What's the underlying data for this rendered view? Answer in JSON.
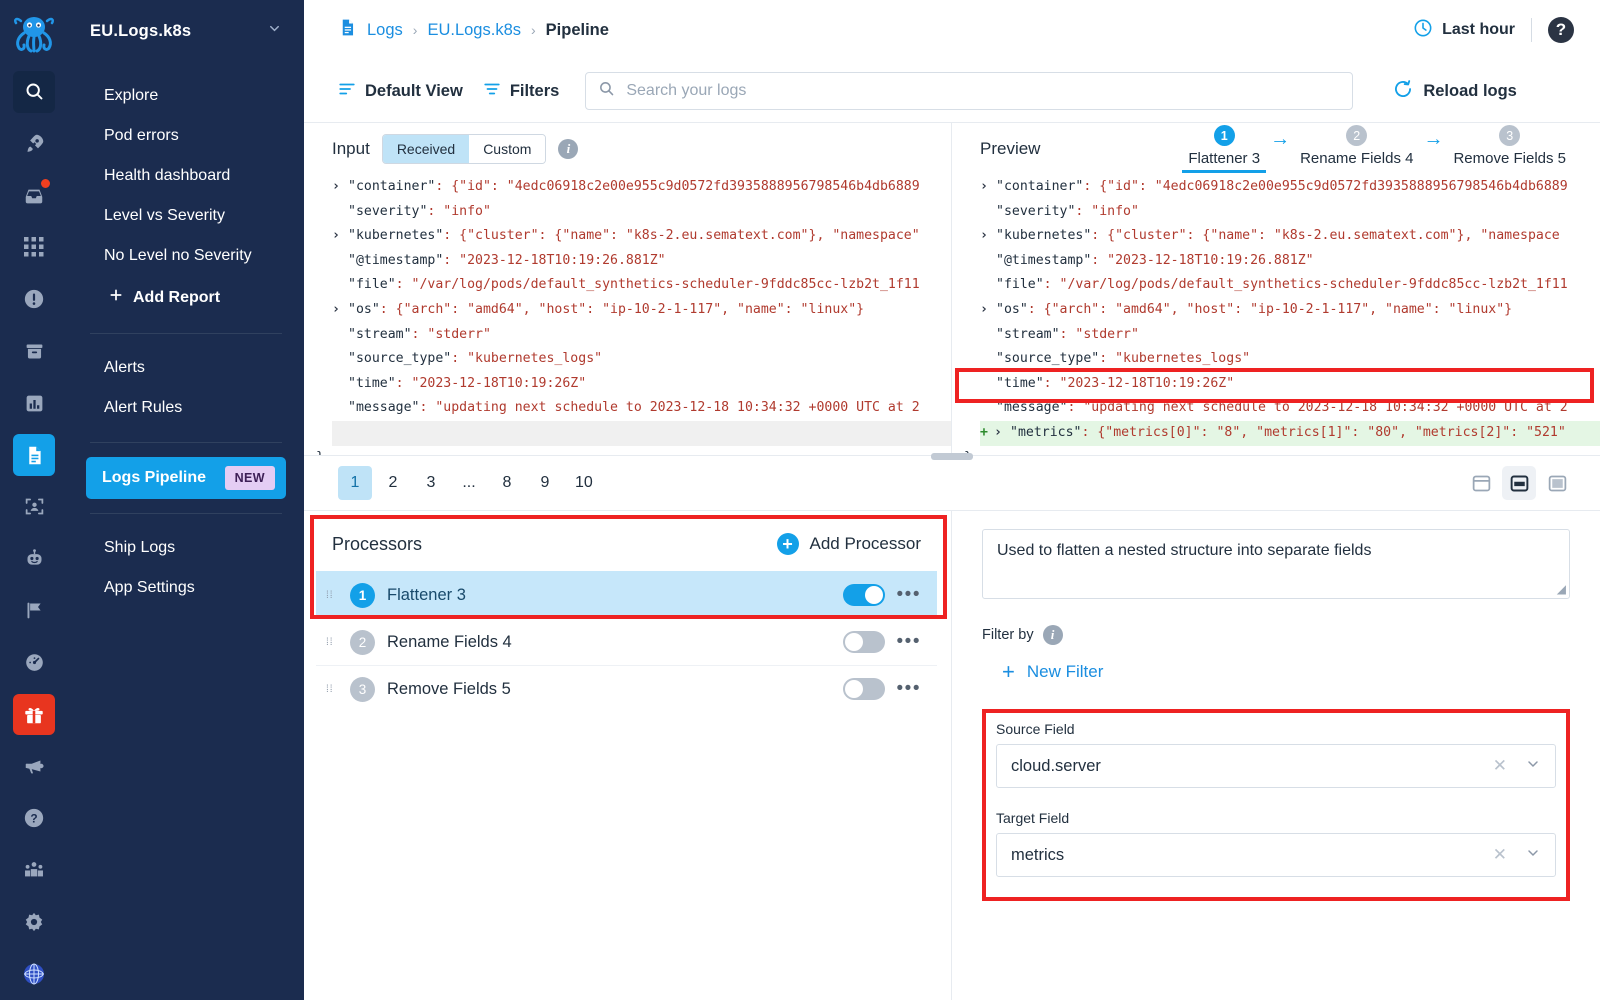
{
  "rail": {
    "logo": "octopus-logo",
    "icons": [
      {
        "name": "search-icon",
        "state": "active-dark"
      },
      {
        "name": "rocket-icon",
        "state": "normal"
      },
      {
        "name": "inbox-icon",
        "state": "normal",
        "badge": true
      },
      {
        "name": "grid-icon",
        "state": "normal"
      },
      {
        "name": "alert-icon",
        "state": "normal"
      },
      {
        "name": "archive-icon",
        "state": "normal"
      },
      {
        "name": "bar-chart-icon",
        "state": "normal"
      },
      {
        "name": "logs-document-icon",
        "state": "active-blue"
      },
      {
        "name": "profile-scan-icon",
        "state": "normal"
      },
      {
        "name": "robot-icon",
        "state": "normal"
      },
      {
        "name": "flag-icon",
        "state": "normal"
      },
      {
        "name": "speedometer-icon",
        "state": "normal"
      }
    ],
    "bottom_icons": [
      {
        "name": "gift-icon",
        "state": "gift"
      },
      {
        "name": "megaphone-icon",
        "state": "normal"
      },
      {
        "name": "help-icon",
        "state": "normal"
      },
      {
        "name": "people-icon",
        "state": "normal"
      },
      {
        "name": "gear-icon",
        "state": "normal"
      },
      {
        "name": "globe-icon",
        "state": "globe"
      }
    ]
  },
  "sidebar": {
    "app_name": "EU.Logs.k8s",
    "chevron": "chevron-down-icon",
    "reports": [
      {
        "label": "Explore"
      },
      {
        "label": "Pod errors"
      },
      {
        "label": "Health dashboard"
      },
      {
        "label": "Level vs Severity"
      },
      {
        "label": "No Level no Severity"
      }
    ],
    "add_report": "Add Report",
    "alerts": [
      {
        "label": "Alerts"
      },
      {
        "label": "Alert Rules"
      }
    ],
    "pipeline": {
      "label": "Logs Pipeline",
      "badge": "NEW"
    },
    "settings": [
      {
        "label": "Ship Logs"
      },
      {
        "label": "App Settings"
      }
    ]
  },
  "header": {
    "breadcrumb": [
      {
        "label": "Logs",
        "type": "link"
      },
      {
        "label": "EU.Logs.k8s",
        "type": "link"
      },
      {
        "label": "Pipeline",
        "type": "current"
      }
    ],
    "time_range": "Last hour",
    "help": "?"
  },
  "toolbar": {
    "default_view": "Default View",
    "filters": "Filters",
    "search_placeholder": "Search your logs",
    "search_value": "",
    "reload": "Reload logs"
  },
  "input_panel": {
    "title": "Input",
    "tabs": [
      {
        "label": "Received",
        "selected": true
      },
      {
        "label": "Custom",
        "selected": false
      }
    ],
    "info": "i",
    "lines": [
      {
        "caret": true,
        "key": "\"container\"",
        "value": ": {\"id\": \"4edc06918c2e00e955c9d0572fd3935888956798546b4db6889"
      },
      {
        "caret": false,
        "key": "\"severity\"",
        "value": ": \"info\""
      },
      {
        "caret": true,
        "key": "\"kubernetes\"",
        "value": ": {\"cluster\": {\"name\": \"k8s-2.eu.sematext.com\"}, \"namespace\""
      },
      {
        "caret": false,
        "key": "\"@timestamp\"",
        "value": ": \"2023-12-18T10:19:26.881Z\""
      },
      {
        "caret": false,
        "key": "\"file\"",
        "value": ": \"/var/log/pods/default_synthetics-scheduler-9fddc85cc-lzb2t_1f11"
      },
      {
        "caret": true,
        "key": "\"os\"",
        "value": ": {\"arch\": \"amd64\", \"host\": \"ip-10-2-1-117\", \"name\": \"linux\"}"
      },
      {
        "caret": false,
        "key": "\"stream\"",
        "value": ": \"stderr\""
      },
      {
        "caret": false,
        "key": "\"source_type\"",
        "value": ": \"kubernetes_logs\""
      },
      {
        "caret": false,
        "key": "\"time\"",
        "value": ": \"2023-12-18T10:19:26Z\""
      },
      {
        "caret": false,
        "key": "\"message\"",
        "value": ": \"updating next schedule to 2023-12-18 10:34:32 +0000 UTC at 2"
      }
    ],
    "closing_brace": "}"
  },
  "preview_panel": {
    "title": "Preview",
    "steps": [
      {
        "num": "1",
        "label": "Flattener 3",
        "active": true
      },
      {
        "num": "2",
        "label": "Rename Fields 4",
        "active": false
      },
      {
        "num": "3",
        "label": "Remove Fields 5",
        "active": false
      }
    ],
    "arrow": "arrow-right-icon",
    "lines": [
      {
        "caret": true,
        "key": "\"container\"",
        "value": ": {\"id\": \"4edc06918c2e00e955c9d0572fd3935888956798546b4db6889"
      },
      {
        "caret": false,
        "key": "\"severity\"",
        "value": ": \"info\""
      },
      {
        "caret": true,
        "key": "\"kubernetes\"",
        "value": ": {\"cluster\": {\"name\": \"k8s-2.eu.sematext.com\"}, \"namespace"
      },
      {
        "caret": false,
        "key": "\"@timestamp\"",
        "value": ": \"2023-12-18T10:19:26.881Z\""
      },
      {
        "caret": false,
        "key": "\"file\"",
        "value": ": \"/var/log/pods/default_synthetics-scheduler-9fddc85cc-lzb2t_1f11"
      },
      {
        "caret": true,
        "key": "\"os\"",
        "value": ": {\"arch\": \"amd64\", \"host\": \"ip-10-2-1-117\", \"name\": \"linux\"}"
      },
      {
        "caret": false,
        "key": "\"stream\"",
        "value": ": \"stderr\""
      },
      {
        "caret": false,
        "key": "\"source_type\"",
        "value": ": \"kubernetes_logs\""
      },
      {
        "caret": false,
        "key": "\"time\"",
        "value": ": \"2023-12-18T10:19:26Z\""
      },
      {
        "caret": false,
        "key": "\"message\"",
        "value": ": \"updating next schedule to 2023-12-18 10:34:32 +0000 UTC at 2"
      }
    ],
    "added_line": {
      "plus": "+",
      "caret": true,
      "key": "\"metrics\"",
      "value": ": {\"metrics[0]\": \"8\", \"metrics[1]\": \"80\", \"metrics[2]\": \"521\""
    },
    "closing_brace": "}"
  },
  "pagination": {
    "pages": [
      "1",
      "2",
      "3",
      "...",
      "8",
      "9",
      "10"
    ],
    "current": "1",
    "view_toggles": [
      {
        "name": "layout-top-icon",
        "selected": false
      },
      {
        "name": "layout-split-icon",
        "selected": true
      },
      {
        "name": "layout-full-icon",
        "selected": false
      }
    ]
  },
  "processors": {
    "title": "Processors",
    "add_label": "Add Processor",
    "rows": [
      {
        "num": "1",
        "name": "Flattener 3",
        "enabled": true,
        "selected": true
      },
      {
        "num": "2",
        "name": "Rename Fields 4",
        "enabled": false,
        "selected": false
      },
      {
        "num": "3",
        "name": "Remove Fields 5",
        "enabled": false,
        "selected": false
      }
    ]
  },
  "detail": {
    "description": "Used to flatten a nested structure into separate fields",
    "filter_by_label": "Filter by",
    "filter_info": "i",
    "new_filter": "New Filter",
    "source_field_label": "Source Field",
    "source_field_value": "cloud.server",
    "target_field_label": "Target Field",
    "target_field_value": "metrics"
  },
  "colors": {
    "sidebar_bg": "#1b2c4f",
    "accent_blue": "#13a0e8",
    "highlight_red": "#ee2222",
    "added_green": "#e4f6e4",
    "selected_row": "#c6e7fa"
  }
}
